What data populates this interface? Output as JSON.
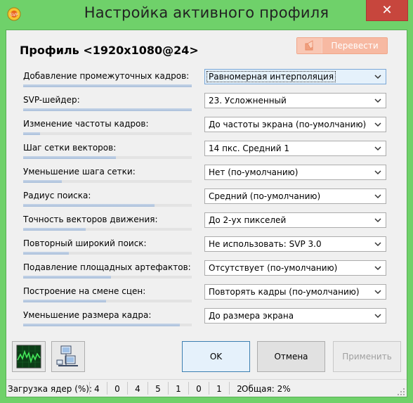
{
  "window": {
    "title": "Настройка активного профиля",
    "close_glyph": "✕"
  },
  "profile": {
    "title": "Профиль <1920x1080@24>",
    "translate_label": "Перевести"
  },
  "rows": [
    {
      "label": "Добавление промежуточных кадров:",
      "value": "Равномерная интерполяция",
      "level": 1.0
    },
    {
      "label": "SVP-шейдер:",
      "value": "23. Усложненный",
      "level": 1.0
    },
    {
      "label": "Изменение частоты кадров:",
      "value": "До частоты экрана (по-умолчанию)",
      "level": 0.1
    },
    {
      "label": "Шаг сетки векторов:",
      "value": "14 пкс. Средний 1",
      "level": 0.55
    },
    {
      "label": "Уменьшение шага сетки:",
      "value": "Нет (по-умолчанию)",
      "level": 0.23
    },
    {
      "label": "Радиус поиска:",
      "value": "Средний (по-умолчанию)",
      "level": 0.78
    },
    {
      "label": "Точность векторов движения:",
      "value": "До 2-ух пикселей",
      "level": 0.37
    },
    {
      "label": "Повторный широкий поиск:",
      "value": "Не использовать: SVP 3.0",
      "level": 0.27
    },
    {
      "label": "Подавление площадных артефактов:",
      "value": "Отсутствует (по-умолчанию)",
      "level": 0.52
    },
    {
      "label": "Построение на смене сцен:",
      "value": "Повторять кадры (по-умолчанию)",
      "level": 0.49
    },
    {
      "label": "Уменьшение размера кадра:",
      "value": "До размера экрана",
      "level": 0.93
    }
  ],
  "buttons": {
    "ok": "OK",
    "cancel": "Отмена",
    "apply": "Применить",
    "graph_icon": "graph-icon",
    "network_icon": "network-icon"
  },
  "status": {
    "label": "Загрузка ядер (%):",
    "cores": [
      "4",
      "0",
      "4",
      "5",
      "1",
      "0",
      "1",
      "2"
    ],
    "total": "Общая: 2%"
  },
  "colors": {
    "frame": "#6fd16a",
    "close": "#c7463d",
    "translate": "#f7b9a2"
  }
}
